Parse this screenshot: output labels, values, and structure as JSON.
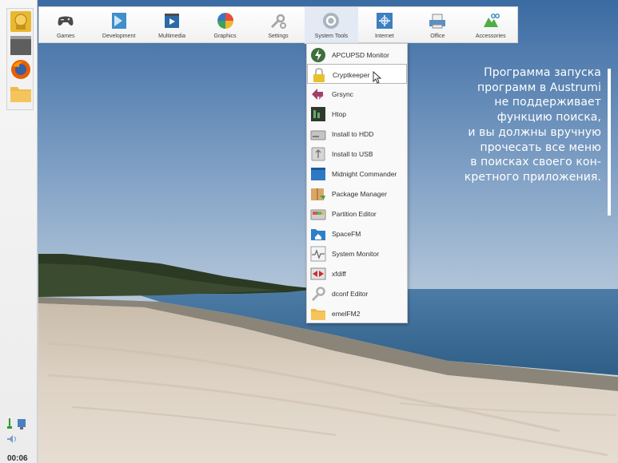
{
  "menubar": {
    "categories": [
      {
        "label": "Games",
        "icon": "gamepad-icon"
      },
      {
        "label": "Development",
        "icon": "development-icon"
      },
      {
        "label": "Multimedia",
        "icon": "multimedia-icon"
      },
      {
        "label": "Graphics",
        "icon": "graphics-icon"
      },
      {
        "label": "Settings",
        "icon": "settings-icon"
      },
      {
        "label": "System Tools",
        "icon": "system-tools-icon"
      },
      {
        "label": "Internet",
        "icon": "internet-icon"
      },
      {
        "label": "Office",
        "icon": "office-icon"
      },
      {
        "label": "Accessories",
        "icon": "accessories-icon"
      }
    ],
    "active": "System Tools"
  },
  "dropdown": {
    "items": [
      {
        "label": "APCUPSD Monitor",
        "icon": "power-icon"
      },
      {
        "label": "Cryptkeeper",
        "icon": "padlock-icon",
        "hovered": true
      },
      {
        "label": "Grsync",
        "icon": "sync-icon"
      },
      {
        "label": "Htop",
        "icon": "terminal-monitor-icon"
      },
      {
        "label": "Install to HDD",
        "icon": "hard-disk-icon"
      },
      {
        "label": "Install to USB",
        "icon": "usb-drive-icon"
      },
      {
        "label": "Midnight Commander",
        "icon": "file-manager-icon"
      },
      {
        "label": "Package Manager",
        "icon": "package-icon"
      },
      {
        "label": "Partition Editor",
        "icon": "disk-partition-icon"
      },
      {
        "label": "SpaceFM",
        "icon": "folder-home-icon"
      },
      {
        "label": "System Monitor",
        "icon": "activity-monitor-icon"
      },
      {
        "label": "xfdiff",
        "icon": "diff-icon"
      },
      {
        "label": "dconf Editor",
        "icon": "wrench-icon"
      },
      {
        "label": "emelFM2",
        "icon": "folder-icon"
      }
    ]
  },
  "caption": {
    "lines": [
      "Программа запуска",
      "программ в Austrumi",
      "не поддерживает",
      "функцию поиска,",
      "и вы должны вручную",
      "прочесать все меню",
      "в поисках своего кон-",
      "кретного приложения."
    ]
  },
  "left_panel": {
    "launchers": [
      "austrumi-logo-icon",
      "terminal-icon",
      "firefox-icon",
      "folder-icon"
    ],
    "clock": "00:06"
  },
  "colors": {
    "sky_top": "#3c6fa6",
    "sky_bottom": "#a9bfd6",
    "sea": "#3e6d97",
    "sand": "#d8ccbd",
    "menu_bg": "#f5f5f5"
  }
}
